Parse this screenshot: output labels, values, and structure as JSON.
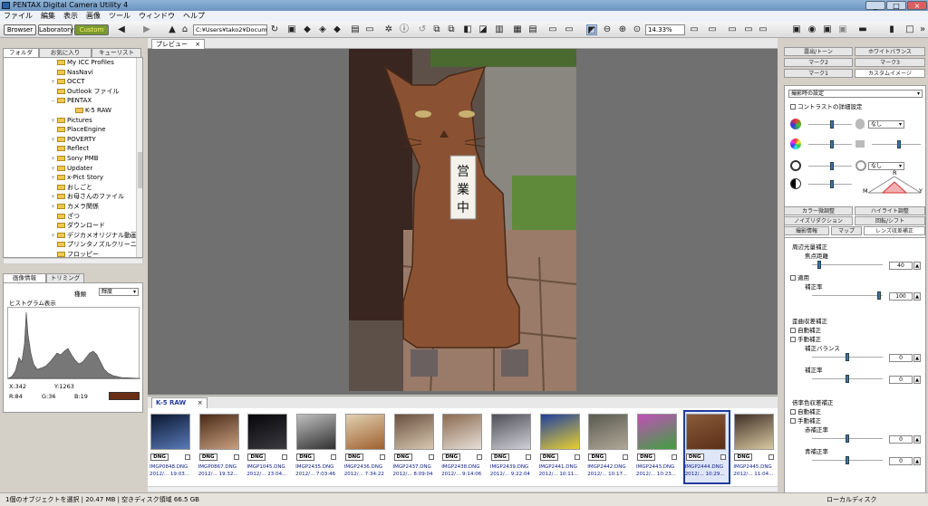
{
  "window": {
    "title": "PENTAX Digital Camera Utility 4",
    "controls": [
      "_",
      "□",
      "×"
    ]
  },
  "menu": [
    "ファイル",
    "編集",
    "表示",
    "画像",
    "ツール",
    "ウィンドウ",
    "ヘルプ"
  ],
  "modes": {
    "browser": "Browser",
    "laboratory": "Laboratory",
    "custom": "Custom"
  },
  "toolbar": {
    "path": "C:¥Users¥tako2¥Docume",
    "zoom": "14.33%"
  },
  "left": {
    "tabs": [
      "フォルダー",
      "お気に入り",
      "キューリスト"
    ],
    "folders": [
      {
        "label": "My ICC Profiles",
        "depth": 2,
        "exp": ""
      },
      {
        "label": "NasNavi",
        "depth": 2,
        "exp": ""
      },
      {
        "label": "OCCT",
        "depth": 2,
        "exp": "+"
      },
      {
        "label": "Outlook ファイル",
        "depth": 2,
        "exp": ""
      },
      {
        "label": "PENTAX",
        "depth": 2,
        "exp": "−"
      },
      {
        "label": "K-5 RAW",
        "depth": 3,
        "exp": ""
      },
      {
        "label": "Pictures",
        "depth": 2,
        "exp": "+"
      },
      {
        "label": "PlaceEngine",
        "depth": 2,
        "exp": ""
      },
      {
        "label": "POVERTY",
        "depth": 2,
        "exp": "+"
      },
      {
        "label": "Reflect",
        "depth": 2,
        "exp": ""
      },
      {
        "label": "Sony PMB",
        "depth": 2,
        "exp": "+"
      },
      {
        "label": "Updater",
        "depth": 2,
        "exp": "+"
      },
      {
        "label": "x-Pict Story",
        "depth": 2,
        "exp": "+"
      },
      {
        "label": "おしごと",
        "depth": 2,
        "exp": ""
      },
      {
        "label": "お母さんのファイル",
        "depth": 2,
        "exp": "+"
      },
      {
        "label": "カメラ関係",
        "depth": 2,
        "exp": "+"
      },
      {
        "label": "ざつ",
        "depth": 2,
        "exp": ""
      },
      {
        "label": "ダウンロード",
        "depth": 2,
        "exp": ""
      },
      {
        "label": "デジカメオリジナル動画",
        "depth": 2,
        "exp": "+"
      },
      {
        "label": "プリンタノズルクリーニ",
        "depth": 2,
        "exp": ""
      },
      {
        "label": "フロッピー",
        "depth": 2,
        "exp": ""
      }
    ],
    "infotabs": [
      "画像情報",
      "トリミング"
    ],
    "kind_label": "種類",
    "kind_value": "輝度",
    "histogram_label": "ヒストグラム表示",
    "x": "X:342",
    "y": "Y:1263",
    "r": "R:84",
    "g": "G:36",
    "b": "B:19"
  },
  "preview": {
    "tab": "プレビュー",
    "close": "×",
    "sign_text": "営業中"
  },
  "thumbs": {
    "tab": "K-5 RAW",
    "close": "×",
    "items": [
      {
        "name": "IMGP0848.DNG",
        "date": "2012/... 19:03...",
        "c1": "#0a1830",
        "c2": "#5a7ab8"
      },
      {
        "name": "IMGP0867.DNG",
        "date": "2012/... 19:32...",
        "c1": "#4a2a18",
        "c2": "#c8a080"
      },
      {
        "name": "IMGP1045.DNG",
        "date": "2012/... 23:04...",
        "c1": "#06060a",
        "c2": "#3a3a40"
      },
      {
        "name": "IMGP2435.DNG",
        "date": "2012/... 7:03:46",
        "c1": "#c0c0c0",
        "c2": "#303030"
      },
      {
        "name": "IMGP2436.DNG",
        "date": "2012/... 7:34:22",
        "c1": "#e0d0b0",
        "c2": "#a06030"
      },
      {
        "name": "IMGP2437.DNG",
        "date": "2012/... 8:09:04",
        "c1": "#6a5040",
        "c2": "#d8c8b0"
      },
      {
        "name": "IMGP2438.DNG",
        "date": "2012/... 9:14:06",
        "c1": "#8a6a50",
        "c2": "#e8e0d8"
      },
      {
        "name": "IMGP2439.DNG",
        "date": "2012/... 9:22:04",
        "c1": "#505058",
        "c2": "#d0d0d8"
      },
      {
        "name": "IMGP2441.DNG",
        "date": "2012/... 10:11...",
        "c1": "#2040a0",
        "c2": "#e8d030"
      },
      {
        "name": "IMGP2442.DNG",
        "date": "2012/... 10:17...",
        "c1": "#5a5a50",
        "c2": "#b0a898"
      },
      {
        "name": "IMGP2443.DNG",
        "date": "2012/... 10:23...",
        "c1": "#c050b8",
        "c2": "#40a040"
      },
      {
        "name": "IMGP2444.DNG",
        "date": "2012/... 10:29...",
        "c1": "#8a5a3a",
        "c2": "#5a3018"
      },
      {
        "name": "IMGP2445.DNG",
        "date": "2012/... 11:04...",
        "c1": "#403028",
        "c2": "#d8c8a0"
      }
    ],
    "badge": "DNG"
  },
  "right": {
    "tabs_row1": [
      "露出/トーン",
      "ホワイトバランス"
    ],
    "tabs_row2": [
      "マーク2",
      "マーク3"
    ],
    "tabs_row3": [
      "マーク1",
      "カスタムイメージ"
    ],
    "custom_dropdown": "撮影時の設定",
    "contrast_label": "コントラストの詳細設定",
    "none1": "なし",
    "none2": "なし",
    "radar": {
      "r": "R",
      "m": "M",
      "y": "Y"
    },
    "tabs_lens1": [
      "カラー微調整",
      "ハイライト調整"
    ],
    "tabs_lens2": [
      "ノイズリダクション",
      "回転/シフト"
    ],
    "tabs_lens3": [
      "撮影情報",
      "マップ",
      "レンズ収差補正"
    ],
    "peripheral_title": "周辺光量補正",
    "focal_label": "焦点距離",
    "focal_value": "40",
    "apply_label": "適用",
    "correct_rate": "補正率",
    "rate_value": "100",
    "distortion_title": "歪曲収差補正",
    "auto1": "自動補正",
    "manual1": "手動補正",
    "correct_balance": "補正バランス",
    "val0a": "0",
    "correct_rate2": "補正率",
    "val0b": "0",
    "chroma_title": "倍率色収差補正",
    "auto2": "自動補正",
    "manual2": "手動補正",
    "red_rate": "赤補正率",
    "val0c": "0",
    "blue_rate": "青補正率",
    "val0d": "0"
  },
  "status": {
    "left": "1個のオブジェクトを選択 | 20.47 MB | 空きディスク領域 66.5 GB",
    "right": "ローカルディスク"
  }
}
